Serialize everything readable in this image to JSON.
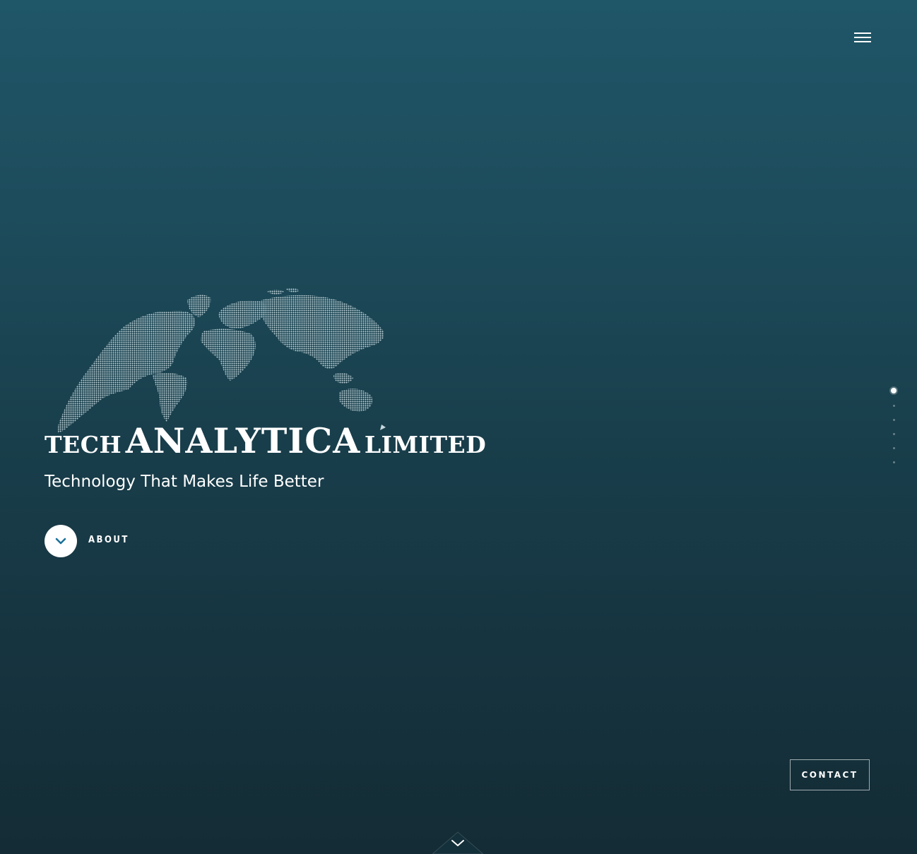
{
  "header": {
    "menu_icon": "hamburger-menu-icon"
  },
  "hero": {
    "logo": {
      "word_left": "TECH",
      "word_main": "ANALYTICA",
      "word_right": "LIMITED",
      "graphic": "dotted-world-map"
    },
    "tagline": "Technology That Makes Life Better",
    "about_button": {
      "label": "ABOUT",
      "icon": "chevron-down-icon"
    }
  },
  "section_nav": {
    "dots": [
      {
        "active": true
      },
      {
        "active": false
      },
      {
        "active": false
      },
      {
        "active": false
      },
      {
        "active": false
      },
      {
        "active": false
      }
    ]
  },
  "contact_button": {
    "label": "CONTACT"
  },
  "scroll_down": {
    "icon": "chevron-down-icon"
  },
  "colors": {
    "background_top": "#1f5668",
    "background_bottom": "#142c35",
    "accent": "#1a6f9a",
    "text": "#ffffff"
  }
}
